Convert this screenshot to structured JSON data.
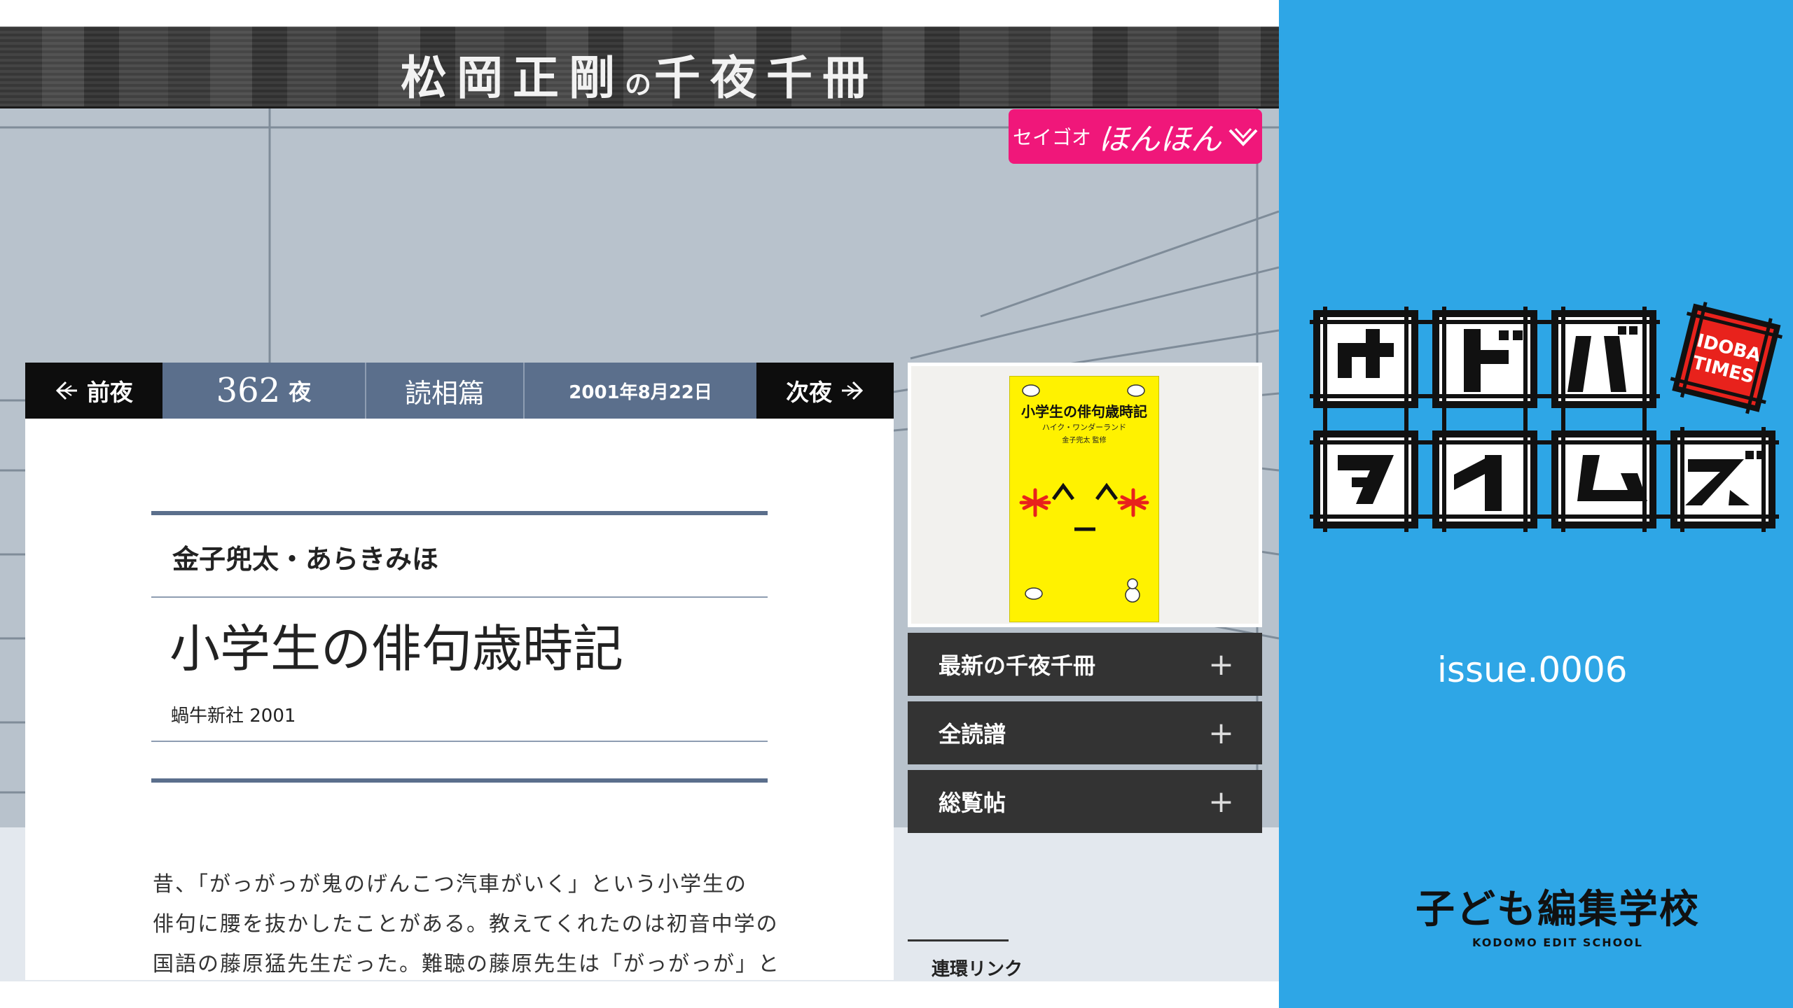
{
  "banner": {
    "title_a": "松岡正剛",
    "title_no": "の",
    "title_b": "千夜千冊"
  },
  "pink_button": {
    "small": "セイゴオ",
    "big": "ほんほん"
  },
  "nav": {
    "prev": "前夜",
    "number": "362",
    "yoru": "夜",
    "category": "読相篇",
    "date": "2001年8月22日",
    "next": "次夜"
  },
  "article": {
    "author": "金子兜太・あらきみほ",
    "title": "小学生の俳句歳時記",
    "publisher": "蝸牛新社 2001",
    "body": [
      "昔、「がっがっが鬼のげんこつ汽車がいく」という小学生の",
      "俳句に腰を抜かしたことがある。教えてくれたのは初音中学の",
      "国語の藤原猛先生だった。難聴の藤原先生は「がっがっが」と"
    ]
  },
  "cover": {
    "title": "小学生の俳句歳時記",
    "subtitle": "ハイク・ワンダーランド",
    "editor": "金子兜太 監修"
  },
  "sidebar_menu": [
    {
      "label": "最新の千夜千冊"
    },
    {
      "label": "全読譜"
    },
    {
      "label": "総覧帖"
    }
  ],
  "related_links_label": "連環リンク",
  "panel": {
    "logo_badge_1": "IDOBA",
    "logo_badge_2": "TIMES",
    "issue": "issue.0006",
    "school_jp": "子ども編集学校",
    "school_en": "KODOMO EDIT SCHOOL"
  },
  "colors": {
    "accent_blue": "#2ea6e6",
    "pink": "#f0177a",
    "nav_blue": "#5b6f8c"
  }
}
